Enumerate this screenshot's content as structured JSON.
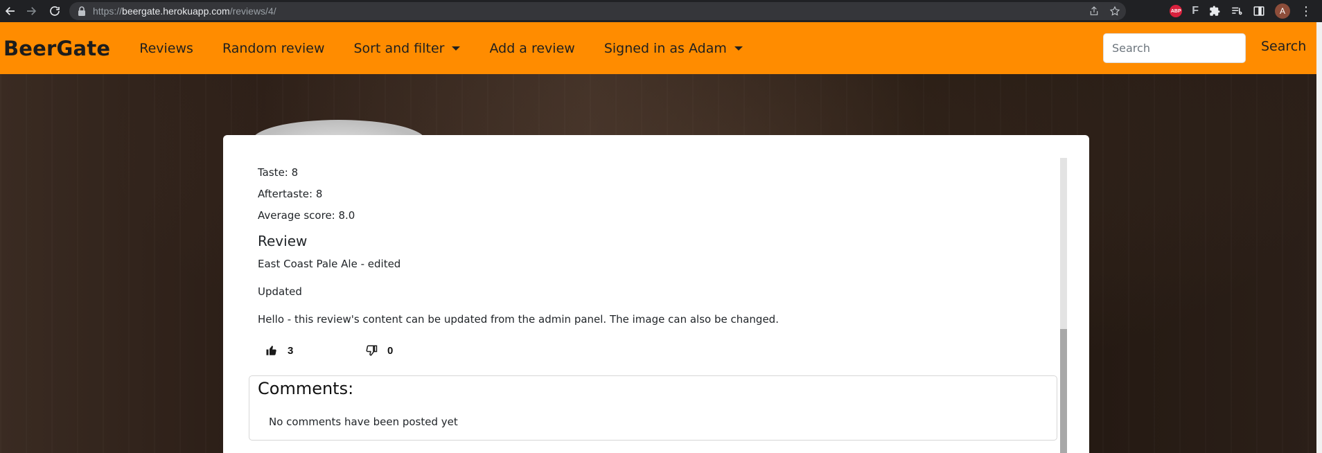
{
  "browser": {
    "url_prefix": "https://",
    "url_host": "beergate.herokuapp.com",
    "url_path": "/reviews/4/",
    "abp_label": "ABP",
    "f_ext_label": "F",
    "profile_initial": "A"
  },
  "navbar": {
    "brand": "BeerGate",
    "items": [
      {
        "label": "Reviews",
        "dropdown": false
      },
      {
        "label": "Random review",
        "dropdown": false
      },
      {
        "label": "Sort and filter",
        "dropdown": true
      },
      {
        "label": "Add a review",
        "dropdown": false
      },
      {
        "label": "Signed in as Adam",
        "dropdown": true
      }
    ],
    "search_placeholder": "Search",
    "search_button": "Search",
    "accent_color": "#ff8c00"
  },
  "review": {
    "taste": "Taste: 8",
    "aftertaste": "Aftertaste: 8",
    "average": "Average score: 8.0",
    "heading": "Review",
    "title_line": "East Coast Pale Ale - edited",
    "status_line": "Updated",
    "body": "Hello - this review's content can be updated from the admin panel. The image can also be changed.",
    "likes": "3",
    "dislikes": "0"
  },
  "comments": {
    "title": "Comments:",
    "empty_text": "No comments have been posted yet"
  }
}
